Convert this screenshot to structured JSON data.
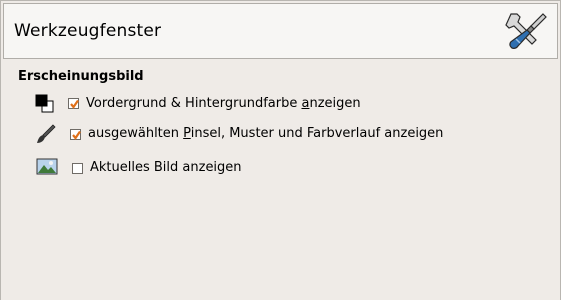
{
  "header": {
    "title": "Werkzeugfenster",
    "icon": "tools-wrench-screwdriver-icon"
  },
  "section": {
    "title": "Erscheinungsbild"
  },
  "options": [
    {
      "icon": "fg-bg-color-icon",
      "checked": true,
      "label_pre": "Vordergrund & Hintergrundfarbe ",
      "label_mnemonic": "a",
      "label_post": "nzeigen"
    },
    {
      "icon": "brush-icon",
      "checked": true,
      "label_pre": "ausgewählten ",
      "label_mnemonic": "P",
      "label_post": "insel, Muster und Farbverlauf anzeigen"
    },
    {
      "icon": "image-icon",
      "checked": false,
      "label_pre": "Aktuelles Bild anzeigen",
      "label_mnemonic": "",
      "label_post": ""
    }
  ],
  "colors": {
    "check_mark": "#e0701a",
    "background": "#efebe7"
  }
}
